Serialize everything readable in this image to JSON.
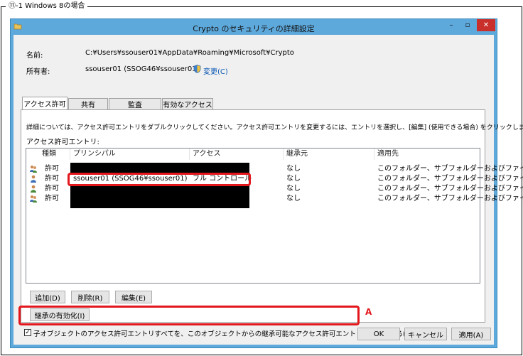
{
  "caption": "⑪-1 Windows 8の場合",
  "window": {
    "title": "Crypto のセキュリティの詳細設定",
    "minimize": "–",
    "maximize": "▫",
    "close": "✕"
  },
  "info": {
    "name_label": "名前:",
    "name_value": "C:¥Users¥ssouser01¥AppData¥Roaming¥Microsoft¥Crypto",
    "owner_label": "所有者:",
    "owner_value": "ssouser01 (SSOG46¥ssouser01)",
    "change_link": "変更(C)"
  },
  "tabs": [
    "アクセス許可",
    "共有",
    "監査",
    "有効なアクセス"
  ],
  "instructions": "詳細については、アクセス許可エントリをダブルクリックしてください。アクセス許可エントリを変更するには、エントリを選択し、[編集] (使用できる場合) をクリックします。",
  "entries_label": "アクセス許可エントリ:",
  "columns": [
    "種類",
    "プリンシパル",
    "アクセス",
    "継承元",
    "適用先"
  ],
  "rows": [
    {
      "type": "許可",
      "principal": "",
      "access": "",
      "inherited": "なし",
      "applies": "このフォルダー、サブフォルダーおよびファイル"
    },
    {
      "type": "許可",
      "principal": "ssouser01 (SSOG46¥ssouser01)",
      "access": "フル コントロール",
      "inherited": "なし",
      "applies": "このフォルダー、サブフォルダーおよびファイル"
    },
    {
      "type": "許可",
      "principal": "",
      "access": "",
      "inherited": "なし",
      "applies": "このフォルダー、サブフォルダーおよびファイル"
    },
    {
      "type": "許可",
      "principal": "",
      "access": "",
      "inherited": "なし",
      "applies": "このフォルダー、サブフォルダーおよびファイル"
    }
  ],
  "buttons": {
    "add": "追加(D)",
    "remove": "削除(R)",
    "edit": "編集(E)",
    "inherit": "継承の有効化(I)",
    "ok": "OK",
    "cancel": "キャンセル",
    "apply": "適用(A)"
  },
  "replace_checkbox": {
    "label": "子オブジェクトのアクセス許可エントリすべてを、このオブジェクトからの継承可能なアクセス許可エントリで置き換える(P)",
    "checked": true,
    "check_mark": "✓"
  },
  "annotation_marker": "A",
  "colors": {
    "highlight": "#e3161b",
    "titlebar": "#5ea9dc",
    "close": "#c9302c"
  }
}
